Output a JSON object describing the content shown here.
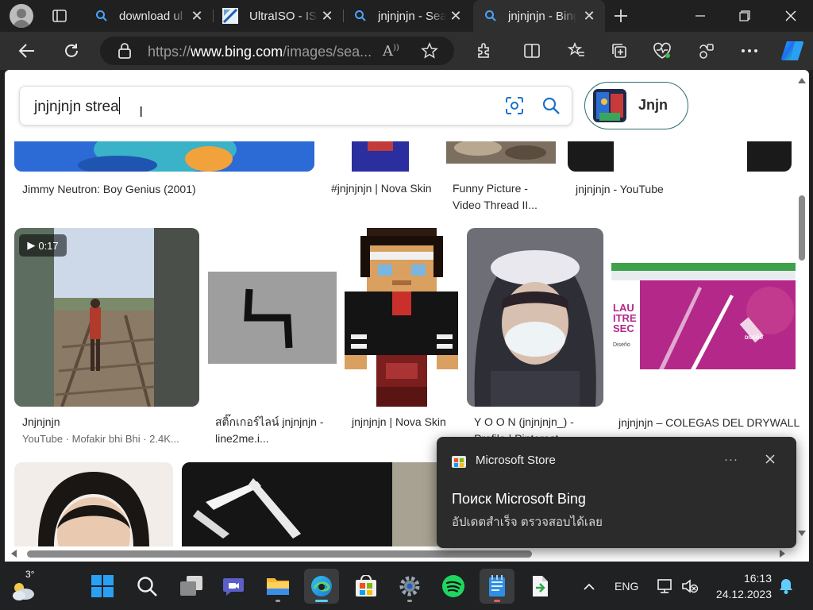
{
  "tabs": [
    {
      "title": "download ul",
      "icon": "bing-search-icon"
    },
    {
      "title": "UltraISO - IS",
      "icon": "ultraiso-icon"
    },
    {
      "title": "jnjnjnjn - Sea",
      "icon": "bing-search-icon"
    },
    {
      "title": "jnjnjnjn - Bing",
      "icon": "bing-search-icon",
      "active": true
    }
  ],
  "address_bar": {
    "url_prefix": "https://",
    "url_domain": "www.bing.com",
    "url_rest": "/images/sea..."
  },
  "search": {
    "query": "jnjnjnjn strea",
    "chip_label": "Jnjn"
  },
  "results": {
    "row1": [
      {
        "caption": "Jimmy Neutron: Boy Genius (2001)"
      },
      {
        "caption": "#jnjnjnjn | Nova Skin"
      },
      {
        "caption": "Funny Picture - Video Thread II..."
      },
      {
        "caption": "jnjnjnjn - YouTube"
      }
    ],
    "row2": [
      {
        "caption": "Jnjnjnjn",
        "source": "YouTube · Mofakir bhi Bhi · 2.4K...",
        "duration": "0:17"
      },
      {
        "caption": "สติ๊กเกอร์ไลน์ jnjnjnjn - line2me.i..."
      },
      {
        "caption": "jnjnjnjn | Nova Skin"
      },
      {
        "caption": "Y O O N (jnjnjnjn_) - Profile | Pinterest"
      },
      {
        "caption": "jnjnjnjn – COLEGAS DEL DRYWALL",
        "banner_text": [
          "LAU",
          "ITRE",
          "SEC"
        ],
        "brand_text": "Diseño",
        "corner_text": "DISEÑO"
      }
    ]
  },
  "notification": {
    "app": "Microsoft Store",
    "title": "Поиск Microsoft Bing",
    "body": "อัปเดตสำเร็จ ตรวจสอบได้เลย"
  },
  "taskbar": {
    "weather_temp": "3°",
    "language": "ENG",
    "time": "16:13",
    "date": "24.12.2023"
  },
  "colors": {
    "accent": "#0078d4",
    "toast_bg": "#2b2b2b",
    "taskbar_bg": "#1f2123"
  }
}
